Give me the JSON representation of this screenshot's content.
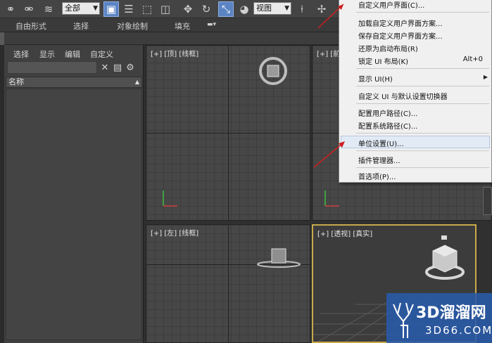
{
  "toolbar": {
    "selection_filter": "全部",
    "reference_coord": "视图",
    "icons": [
      "link-icon",
      "unlink-icon",
      "bind-icon",
      "select-object-icon",
      "select-by-name-icon",
      "rect-selection-icon",
      "window-crossing-icon",
      "move-icon",
      "rotate-icon",
      "scale-icon",
      "pivot-icon",
      "mirror-icon",
      "align-icon",
      "snap-icon"
    ]
  },
  "ribbon": {
    "tabs": [
      "自由形式",
      "选择",
      "对象绘制",
      "填充"
    ],
    "extra_icon": "dropdown-icon"
  },
  "explorer": {
    "menus": [
      "选择",
      "显示",
      "编辑",
      "自定义"
    ],
    "search_placeholder": "",
    "column_header": "名称"
  },
  "viewports": {
    "top_left_label": "[+] [顶] [线框]",
    "top_right_label": "[+] [前",
    "bottom_left_label": "[+] [左] [线框]",
    "bottom_right_label": "[+] [透视] [真实]"
  },
  "context_menu": {
    "items": [
      {
        "label": "自定义用户界面(C)...",
        "shortcut": ""
      },
      {
        "label": "加载自定义用户界面方案...",
        "shortcut": ""
      },
      {
        "label": "保存自定义用户界面方案...",
        "shortcut": ""
      },
      {
        "label": "还原为启动布局(R)",
        "shortcut": ""
      },
      {
        "label": "锁定 UI 布局(K)",
        "shortcut": "Alt+0"
      },
      {
        "label": "显示 UI(H)",
        "shortcut": "",
        "submenu": true
      },
      {
        "label": "自定义 UI 与默认设置切换器",
        "shortcut": ""
      },
      {
        "label": "配置用户路径(C)...",
        "shortcut": ""
      },
      {
        "label": "配置系统路径(C)...",
        "shortcut": ""
      },
      {
        "label": "单位设置(U)...",
        "shortcut": "",
        "highlighted": true
      },
      {
        "label": "插件管理器...",
        "shortcut": ""
      },
      {
        "label": "首选项(P)...",
        "shortcut": ""
      }
    ]
  },
  "watermark": {
    "title": "3D溜溜网",
    "url": "3D66.COM"
  },
  "colors": {
    "toolbar_bg": "#444444",
    "viewport_bg": "#474747",
    "active_viewport_border": "#c8a94a",
    "menu_bg": "#f0f0f0",
    "highlight": "#e2eaf5",
    "watermark_bg": "#2c5aaa",
    "annotation_arrow": "#cc1f1f"
  }
}
